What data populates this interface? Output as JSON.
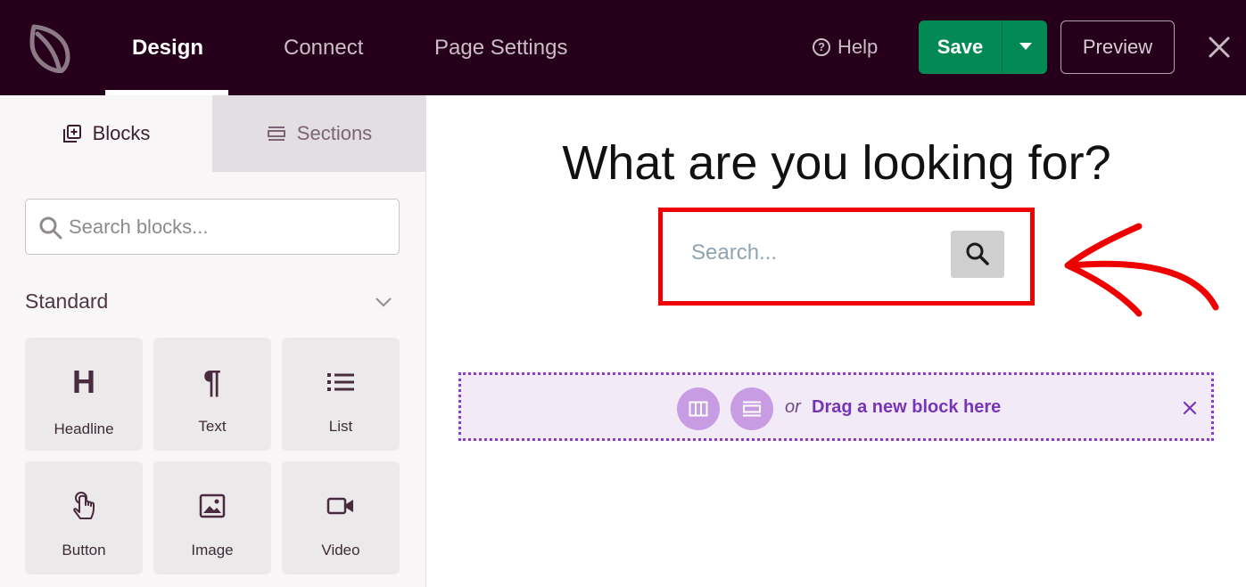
{
  "topbar": {
    "tabs": [
      {
        "label": "Design",
        "active": true
      },
      {
        "label": "Connect",
        "active": false
      },
      {
        "label": "Page Settings",
        "active": false
      }
    ],
    "help_label": "Help",
    "save_label": "Save",
    "preview_label": "Preview"
  },
  "sidebar": {
    "tabs": {
      "blocks": "Blocks",
      "sections": "Sections"
    },
    "search_placeholder": "Search blocks...",
    "category_label": "Standard",
    "blocks": [
      {
        "label": "Headline",
        "icon": "headline-icon"
      },
      {
        "label": "Text",
        "icon": "paragraph-icon"
      },
      {
        "label": "List",
        "icon": "list-icon"
      },
      {
        "label": "Button",
        "icon": "hand-pointer-icon"
      },
      {
        "label": "Image",
        "icon": "image-icon"
      },
      {
        "label": "Video",
        "icon": "video-camera-icon"
      }
    ]
  },
  "canvas": {
    "heading": "What are you looking for?",
    "search_placeholder": "Search...",
    "drop_zone": {
      "or_label": "or",
      "text": "Drag a new block here"
    }
  },
  "colors": {
    "topbar_bg": "#26001a",
    "save_green": "#038a54",
    "highlight_red": "#ee0000",
    "drop_purple": "#7635b8"
  }
}
